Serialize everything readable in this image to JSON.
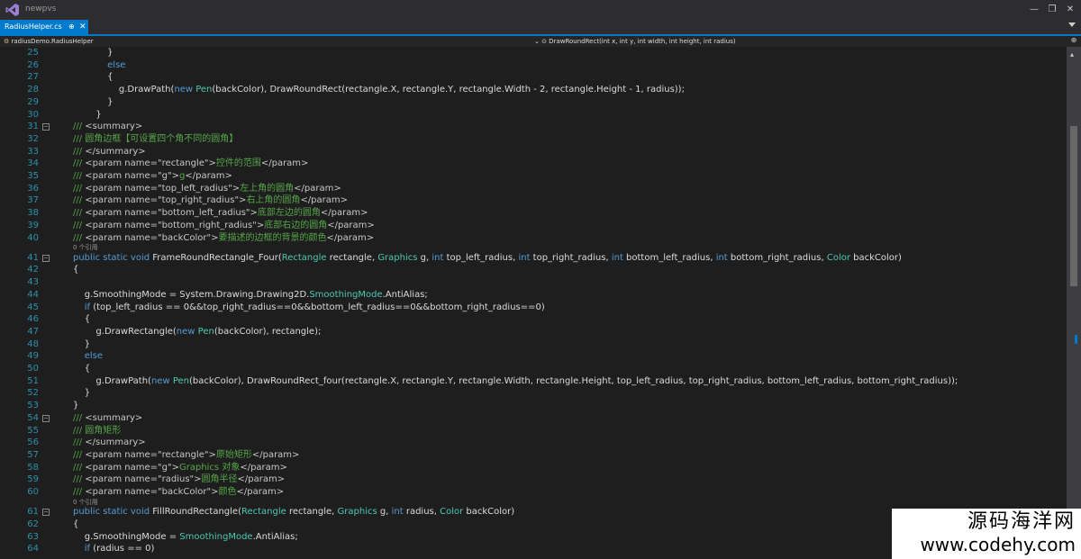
{
  "window": {
    "title": "newpvs",
    "minimize": "—",
    "restore": "❐",
    "close": "✕"
  },
  "tab": {
    "label": "RadiusHelper.cs",
    "pin": "⊕",
    "close": "✕"
  },
  "navbar": {
    "class_path": "radiusDemo.RadiusHelper",
    "member": "⊙ DrawRoundRect(int x, int y, int width, int height, int radius)"
  },
  "colors": {
    "keyword": "#569cd6",
    "type": "#4ec9b0",
    "comment": "#57a64a",
    "accent": "#007acc",
    "line_number": "#2b91af"
  },
  "lines": [
    {
      "n": "25",
      "fold": "",
      "parts": [
        [
          "t",
          "            }"
        ]
      ]
    },
    {
      "n": "26",
      "fold": "",
      "parts": [
        [
          "k",
          "            else"
        ]
      ]
    },
    {
      "n": "27",
      "fold": "",
      "parts": [
        [
          "t",
          "            {"
        ]
      ]
    },
    {
      "n": "28",
      "fold": "",
      "parts": [
        [
          "t",
          "                g.DrawPath("
        ],
        [
          "k",
          "new "
        ],
        [
          "y",
          "Pen"
        ],
        [
          "t",
          "(backColor), DrawRoundRect(rectangle.X, rectangle.Y, rectangle.Width - 2, rectangle.Height - 1, radius));"
        ]
      ]
    },
    {
      "n": "29",
      "fold": "",
      "parts": [
        [
          "t",
          "            }"
        ]
      ]
    },
    {
      "n": "30",
      "fold": "",
      "parts": [
        [
          "t",
          "        }"
        ]
      ]
    },
    {
      "n": "31",
      "fold": "−",
      "parts": [
        [
          "c",
          "/// "
        ],
        [
          "x",
          "<summary>"
        ]
      ]
    },
    {
      "n": "32",
      "fold": "",
      "parts": [
        [
          "c",
          "/// 圆角边框【可设置四个角不同的圆角】"
        ]
      ]
    },
    {
      "n": "33",
      "fold": "",
      "parts": [
        [
          "c",
          "/// "
        ],
        [
          "x",
          "</summary>"
        ]
      ]
    },
    {
      "n": "34",
      "fold": "",
      "parts": [
        [
          "c",
          "/// "
        ],
        [
          "x",
          "<param name=\"rectangle\">"
        ],
        [
          "c",
          "控件的范围"
        ],
        [
          "x",
          "</param>"
        ]
      ]
    },
    {
      "n": "35",
      "fold": "",
      "parts": [
        [
          "c",
          "/// "
        ],
        [
          "x",
          "<param name=\"g\">"
        ],
        [
          "c",
          "g"
        ],
        [
          "x",
          "</param>"
        ]
      ]
    },
    {
      "n": "36",
      "fold": "",
      "parts": [
        [
          "c",
          "/// "
        ],
        [
          "x",
          "<param name=\"top_left_radius\">"
        ],
        [
          "c",
          "左上角的圆角"
        ],
        [
          "x",
          "</param>"
        ]
      ]
    },
    {
      "n": "37",
      "fold": "",
      "parts": [
        [
          "c",
          "/// "
        ],
        [
          "x",
          "<param name=\"top_right_radius\">"
        ],
        [
          "c",
          "右上角的圆角"
        ],
        [
          "x",
          "</param>"
        ]
      ]
    },
    {
      "n": "38",
      "fold": "",
      "parts": [
        [
          "c",
          "/// "
        ],
        [
          "x",
          "<param name=\"bottom_left_radius\">"
        ],
        [
          "c",
          "底部左边的圆角"
        ],
        [
          "x",
          "</param>"
        ]
      ]
    },
    {
      "n": "39",
      "fold": "",
      "parts": [
        [
          "c",
          "/// "
        ],
        [
          "x",
          "<param name=\"bottom_right_radius\">"
        ],
        [
          "c",
          "底部右边的圆角"
        ],
        [
          "x",
          "</param>"
        ]
      ]
    },
    {
      "n": "40",
      "fold": "",
      "parts": [
        [
          "c",
          "/// "
        ],
        [
          "x",
          "<param name=\"backColor\">"
        ],
        [
          "c",
          "要描述的边框的背景的颜色"
        ],
        [
          "x",
          "</param>"
        ]
      ],
      "lens": "0 个引用"
    },
    {
      "n": "41",
      "fold": "−",
      "parts": [
        [
          "k",
          "public static void "
        ],
        [
          "t",
          "FrameRoundRectangle_Four("
        ],
        [
          "y",
          "Rectangle "
        ],
        [
          "t",
          "rectangle, "
        ],
        [
          "y",
          "Graphics "
        ],
        [
          "t",
          "g, "
        ],
        [
          "k",
          "int "
        ],
        [
          "t",
          "top_left_radius, "
        ],
        [
          "k",
          "int "
        ],
        [
          "t",
          "top_right_radius, "
        ],
        [
          "k",
          "int "
        ],
        [
          "t",
          "bottom_left_radius, "
        ],
        [
          "k",
          "int "
        ],
        [
          "t",
          "bottom_right_radius, "
        ],
        [
          "y",
          "Color "
        ],
        [
          "t",
          "backColor)"
        ]
      ]
    },
    {
      "n": "42",
      "fold": "",
      "parts": [
        [
          "t",
          "{"
        ]
      ]
    },
    {
      "n": "43",
      "fold": "",
      "parts": [
        [
          "t",
          ""
        ]
      ]
    },
    {
      "n": "44",
      "fold": "",
      "parts": [
        [
          "t",
          "    g.SmoothingMode = System.Drawing.Drawing2D."
        ],
        [
          "y",
          "SmoothingMode"
        ],
        [
          "t",
          ".AntiAlias;"
        ]
      ]
    },
    {
      "n": "45",
      "fold": "",
      "parts": [
        [
          "k",
          "    if "
        ],
        [
          "t",
          "(top_left_radius == 0&&top_right_radius==0&&bottom_left_radius==0&&bottom_right_radius==0)"
        ]
      ]
    },
    {
      "n": "46",
      "fold": "",
      "parts": [
        [
          "t",
          "    {"
        ]
      ]
    },
    {
      "n": "47",
      "fold": "",
      "parts": [
        [
          "t",
          "        g.DrawRectangle("
        ],
        [
          "k",
          "new "
        ],
        [
          "y",
          "Pen"
        ],
        [
          "t",
          "(backColor), rectangle);"
        ]
      ]
    },
    {
      "n": "48",
      "fold": "",
      "parts": [
        [
          "t",
          "    }"
        ]
      ]
    },
    {
      "n": "49",
      "fold": "",
      "parts": [
        [
          "k",
          "    else"
        ]
      ]
    },
    {
      "n": "50",
      "fold": "",
      "parts": [
        [
          "t",
          "    {"
        ]
      ]
    },
    {
      "n": "51",
      "fold": "",
      "parts": [
        [
          "t",
          "        g.DrawPath("
        ],
        [
          "k",
          "new "
        ],
        [
          "y",
          "Pen"
        ],
        [
          "t",
          "(backColor), DrawRoundRect_four(rectangle.X, rectangle.Y, rectangle.Width, rectangle.Height, top_left_radius, top_right_radius, bottom_left_radius, bottom_right_radius));"
        ]
      ]
    },
    {
      "n": "52",
      "fold": "",
      "parts": [
        [
          "t",
          "    }"
        ]
      ]
    },
    {
      "n": "53",
      "fold": "",
      "parts": [
        [
          "t",
          "}"
        ]
      ]
    },
    {
      "n": "54",
      "fold": "−",
      "parts": [
        [
          "c",
          "/// "
        ],
        [
          "x",
          "<summary>"
        ]
      ]
    },
    {
      "n": "55",
      "fold": "",
      "parts": [
        [
          "c",
          "/// 圆角矩形"
        ]
      ]
    },
    {
      "n": "56",
      "fold": "",
      "parts": [
        [
          "c",
          "/// "
        ],
        [
          "x",
          "</summary>"
        ]
      ]
    },
    {
      "n": "57",
      "fold": "",
      "parts": [
        [
          "c",
          "/// "
        ],
        [
          "x",
          "<param name=\"rectangle\">"
        ],
        [
          "c",
          "原始矩形"
        ],
        [
          "x",
          "</param>"
        ]
      ]
    },
    {
      "n": "58",
      "fold": "",
      "parts": [
        [
          "c",
          "/// "
        ],
        [
          "x",
          "<param name=\"g\">"
        ],
        [
          "c",
          "Graphics 对象"
        ],
        [
          "x",
          "</param>"
        ]
      ]
    },
    {
      "n": "59",
      "fold": "",
      "parts": [
        [
          "c",
          "/// "
        ],
        [
          "x",
          "<param name=\"radius\">"
        ],
        [
          "c",
          "圆角半径"
        ],
        [
          "x",
          "</param>"
        ]
      ]
    },
    {
      "n": "60",
      "fold": "",
      "parts": [
        [
          "c",
          "/// "
        ],
        [
          "x",
          "<param name=\"backColor\">"
        ],
        [
          "c",
          "颜色"
        ],
        [
          "x",
          "</param>"
        ]
      ],
      "lens": "0 个引用"
    },
    {
      "n": "61",
      "fold": "−",
      "parts": [
        [
          "k",
          "public static void "
        ],
        [
          "t",
          "FillRoundRectangle("
        ],
        [
          "y",
          "Rectangle "
        ],
        [
          "t",
          "rectangle, "
        ],
        [
          "y",
          "Graphics "
        ],
        [
          "t",
          "g, "
        ],
        [
          "k",
          "int "
        ],
        [
          "t",
          "radius, "
        ],
        [
          "y",
          "Color "
        ],
        [
          "t",
          "backColor)"
        ]
      ]
    },
    {
      "n": "62",
      "fold": "",
      "parts": [
        [
          "t",
          "{"
        ]
      ]
    },
    {
      "n": "63",
      "fold": "",
      "parts": [
        [
          "t",
          "    g.SmoothingMode = "
        ],
        [
          "y",
          "SmoothingMode"
        ],
        [
          "t",
          ".AntiAlias;"
        ]
      ]
    },
    {
      "n": "64",
      "fold": "",
      "parts": [
        [
          "k",
          "    if "
        ],
        [
          "t",
          "(radius == 0)"
        ]
      ]
    }
  ],
  "watermark": {
    "line1": "源码海洋网",
    "line2": "www.codehy.com"
  }
}
